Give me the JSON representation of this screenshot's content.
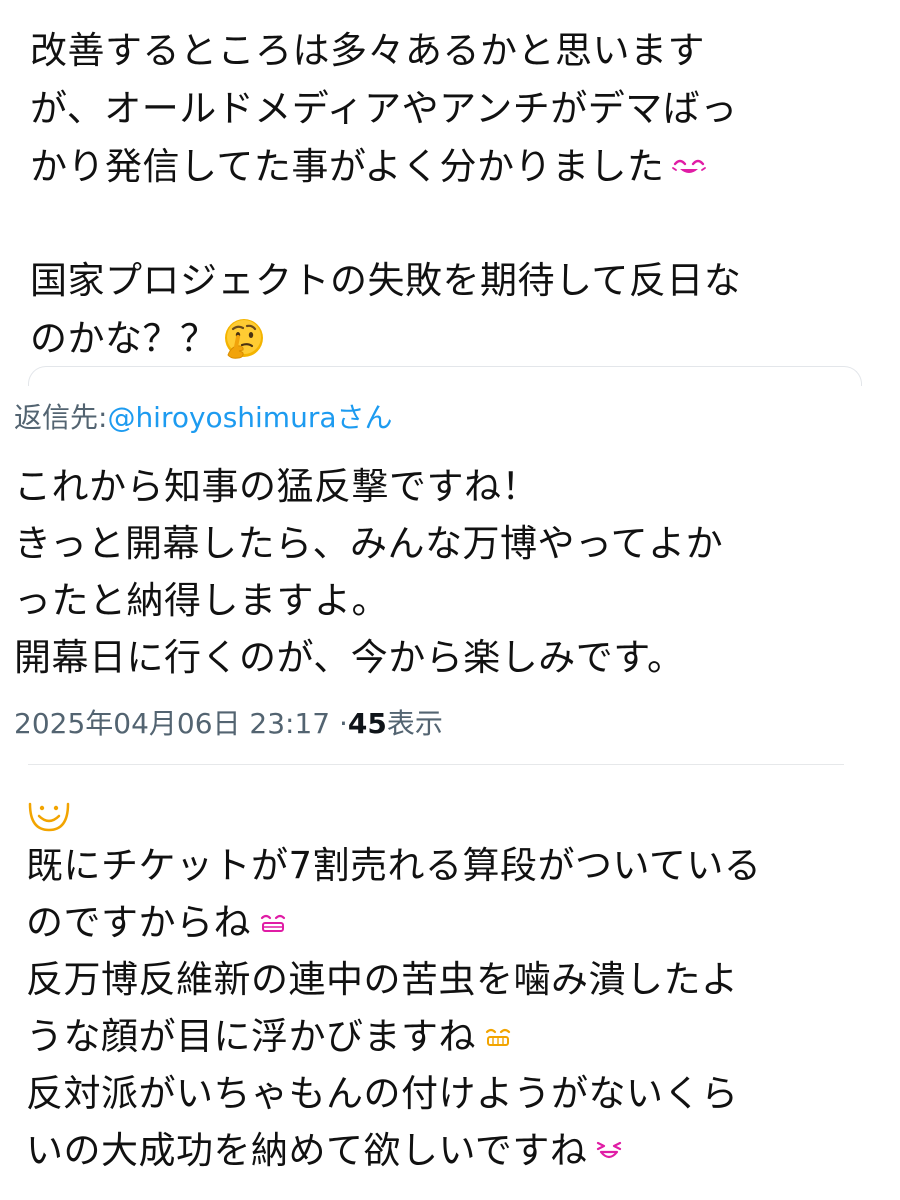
{
  "post": {
    "lines": [
      "改善するところは多々あるかと思います",
      "が、オールドメディアやアンチがデマばっ",
      "かり発信してた事がよく分かりました",
      "",
      "国家プロジェクトの失敗を期待して反日な",
      "のかな？？"
    ]
  },
  "reply": {
    "reply_to_prefix": "返信先: ",
    "reply_to_handle": "@hiroyoshimura",
    "reply_to_suffix": "さん",
    "lines": [
      "これから知事の猛反撃ですね！",
      "きっと開幕したら、みんな万博やってよか",
      "ったと納得しますよ。",
      "開幕日に行くのが、今から楽しみです。"
    ],
    "timestamp": "2025年04月06日 23:17 · ",
    "views_count": "45",
    "views_label": " 表示"
  },
  "bottom_post": {
    "lines": [
      "既にチケットが7割売れる算段がついている",
      "のですからね",
      "反万博反維新の連中の苦虫を噛み潰したよ",
      "うな顔が目に浮かびますね",
      "反対派がいちゃもんの付けようがないくら",
      "いの大成功を納めて欲しいですね"
    ]
  },
  "icons": {
    "smile_pink": "smiling-face-pink-icon",
    "thinking": "thinking-face-icon",
    "top_smile": "smiling-face-orange-icon",
    "grin_pink": "grinning-face-pink-icon",
    "grin_orange": "grinning-face-orange-icon",
    "laugh_pink": "laughing-face-pink-icon"
  },
  "colors": {
    "text": "#111111",
    "meta": "#536471",
    "link": "#1d9bf0",
    "emoji_pink": "#e01ca5",
    "emoji_orange": "#f2a400",
    "thinking_face": "#f4b400"
  }
}
